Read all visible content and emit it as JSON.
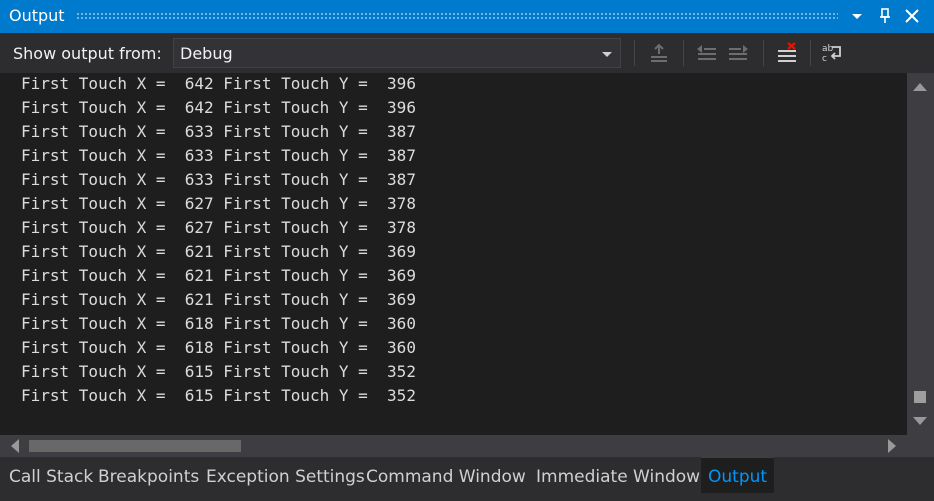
{
  "window": {
    "title": "Output",
    "buttons": {
      "dropdown": "▾",
      "pin": "📌",
      "close": "✕"
    }
  },
  "toolbar": {
    "show_output_label": "Show output from:",
    "source_selected": "Debug"
  },
  "output_lines": [
    "First Touch X =  642 First Touch Y =  396",
    "First Touch X =  642 First Touch Y =  396",
    "First Touch X =  633 First Touch Y =  387",
    "First Touch X =  633 First Touch Y =  387",
    "First Touch X =  633 First Touch Y =  387",
    "First Touch X =  627 First Touch Y =  378",
    "First Touch X =  627 First Touch Y =  378",
    "First Touch X =  621 First Touch Y =  369",
    "First Touch X =  621 First Touch Y =  369",
    "First Touch X =  621 First Touch Y =  369",
    "First Touch X =  618 First Touch Y =  360",
    "First Touch X =  618 First Touch Y =  360",
    "First Touch X =  615 First Touch Y =  352",
    "First Touch X =  615 First Touch Y =  352"
  ],
  "tabs": [
    {
      "label": "Call Stack",
      "active": false
    },
    {
      "label": "Breakpoints",
      "active": false
    },
    {
      "label": "Exception Settings",
      "active": false
    },
    {
      "label": "Command Window",
      "active": false
    },
    {
      "label": "Immediate Window",
      "active": false
    },
    {
      "label": "Output",
      "active": true
    }
  ],
  "colors": {
    "accent": "#007acc",
    "active_tab_text": "#0097fb",
    "output_background": "#1e1e1e",
    "output_text": "#dcdcdc"
  }
}
